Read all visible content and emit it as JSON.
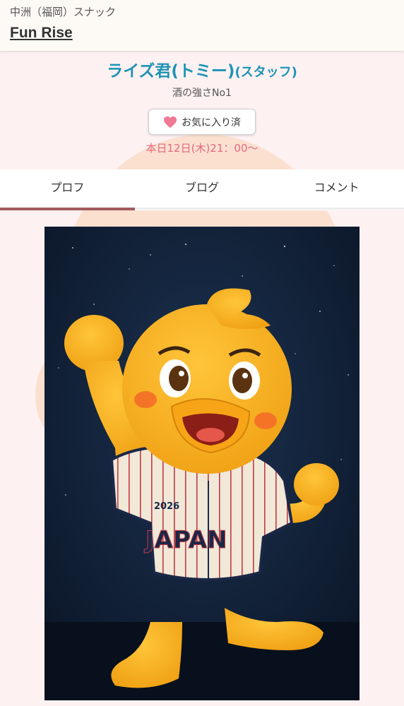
{
  "header": {
    "shop_area": "中洲（福岡）スナック",
    "shop_name": "Fun Rise"
  },
  "profile": {
    "cast_name": "ライズ君(トミー)",
    "role": "(スタッフ)",
    "catchphrase": "酒の強さNo1",
    "favorite_label": "お気に入り済",
    "schedule": "本日12日(木)21：00〜"
  },
  "tabs": [
    {
      "label": "プロフ",
      "active": true
    },
    {
      "label": "ブログ",
      "active": false
    },
    {
      "label": "コメント",
      "active": false
    }
  ],
  "photo": {
    "jersey_year": "2026",
    "jersey_text": "JAPAN"
  },
  "colors": {
    "accent_name": "#1d93b4",
    "schedule": "#e26a7e",
    "heart": "#f07a95",
    "tab_indicator": "#a35b5e",
    "page_bg": "#fdf1f2"
  }
}
